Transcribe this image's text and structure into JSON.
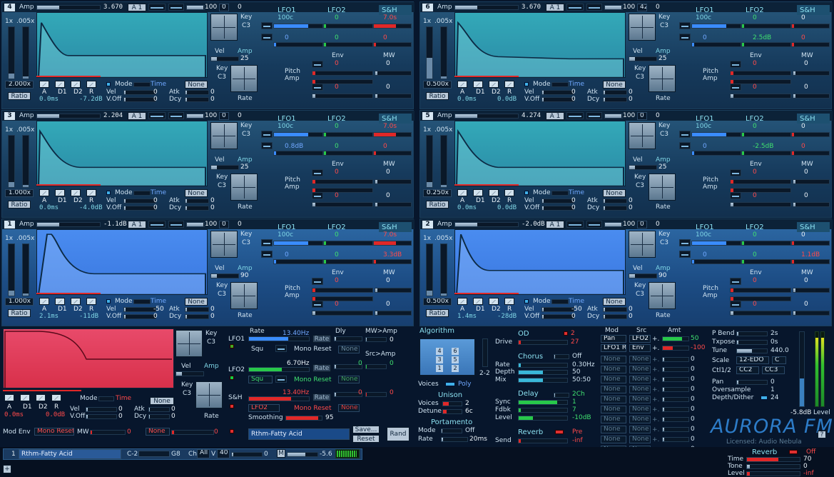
{
  "colors": {
    "accent": "#3a8cff",
    "red": "#e02828",
    "green": "#28c84a",
    "cyan": "#7fd6e6",
    "bg": "#07162c"
  },
  "ops": [
    {
      "num": "4",
      "amp": "3.670",
      "ratio": "2.000x",
      "a": "0.0ms",
      "dr": "-7.2dB",
      "lfo1": "100c",
      "sh": "7.0s",
      "vel": "25",
      "pitch_val": "0",
      "mono_amp": "0",
      "key": "C3",
      "red_val": "0",
      "green_val": "",
      "sel": false
    },
    {
      "num": "6",
      "amp": "3.670",
      "ratio": "0.500x",
      "a": "0.0ms",
      "dr": "0.0dB",
      "lfo1": "100c",
      "sh": "0",
      "vel": "25",
      "key": "C3",
      "green_val": "2.5dB",
      "box": "42"
    },
    {
      "num": "3",
      "amp": "2.204",
      "ratio": "1.000x",
      "a": "0.0ms",
      "dr": "-4.0dB",
      "lfo1": "100c",
      "sh": "7.0s",
      "vel": "25",
      "key": "C3",
      "blue_val": "0.8dB"
    },
    {
      "num": "5",
      "amp": "4.274",
      "ratio": "0.250x",
      "a": "0.0ms",
      "dr": "0.0dB",
      "lfo1": "100c",
      "sh": "0",
      "vel": "25",
      "key": "C3",
      "green_val": "-2.5dB"
    },
    {
      "num": "1",
      "amp": "-1.1dB",
      "ratio": "1.000x",
      "a": "2.1ms",
      "dr": "-11dB",
      "lfo1": "100c",
      "sh": "7.0s",
      "vel": "90",
      "key": "C3",
      "red_val": "3.3dB",
      "atk": "-50"
    },
    {
      "num": "2",
      "amp": "-2.0dB",
      "ratio": "0.500x",
      "a": "1.4ms",
      "dr": "-28dB",
      "lfo1": "100c",
      "sh": "0",
      "vel": "90",
      "key": "C3",
      "red_val": "1.1dB",
      "atk": "-50"
    }
  ],
  "labels": {
    "amp": "Amp",
    "a1": "A 1",
    "hundred": "100",
    "zero": "0",
    "one_x": "1x",
    "dot005": ".005x",
    "ratio": "Ratio",
    "key": "Key",
    "vel": "Vel",
    "rate": "Rate",
    "mode": "Mode",
    "time": "Time",
    "none": "None",
    "atk": "Atk",
    "dcy": "Dcy",
    "vel_l": "Vel",
    "voff": "V.Off",
    "lfo1": "LFO1",
    "lfo2": "LFO2",
    "sh": "S&H",
    "env": "Env",
    "mw": "MW",
    "pitch": "Pitch",
    "amp2": "Amp",
    "A": "A",
    "D1": "D1",
    "D2": "D2",
    "R": "R"
  },
  "bottom": {
    "mode": "Mode",
    "time": "Time",
    "none": "None",
    "a": "0.0ms",
    "dr": "0.0dB",
    "atk": "Atk",
    "dcy": "Dcy",
    "vel": "Vel",
    "voff": "V.Off",
    "amp": "Amp",
    "key": "Key",
    "c3": "C3",
    "rate": "Rate",
    "lfo1": "LFO1",
    "lfo2": "LFO2",
    "sh": "S&H",
    "rate_l": "Rate",
    "dly": "Dly",
    "mwamp": "MW>Amp",
    "srcamp": "Src>Amp",
    "lfo1_rate": "13.40Hz",
    "lfo2_rate": "6.70Hz",
    "sh_rate": "13.40Hz",
    "rate_btn": "Rate",
    "squ": "Squ",
    "mono_reset": "Mono Reset",
    "lfo2_btn": "LFO2",
    "smoothing": "Smoothing",
    "smooth_val": "95",
    "mod_env": "Mod Env",
    "mw": "MW",
    "preset": "Rthm-Fatty Acid",
    "save": "Save...",
    "reset": "Reset",
    "rand": "Rand",
    "algorithm": "Algorithm",
    "alg_nums": [
      "4",
      "6",
      "3",
      "5",
      "1",
      "2"
    ],
    "alg_val": "2-2",
    "voices": "Voices",
    "poly": "Poly",
    "unison": "Unison",
    "voices2": "Voices",
    "voices_val": "2",
    "detune": "Detune",
    "detune_val": "6c",
    "portamento": "Portamento",
    "port_mode": "Mode",
    "port_off": "Off",
    "port_rate": "Rate",
    "port_val": "20ms",
    "od": "OD",
    "drive": "Drive",
    "od_val1": "2",
    "od_val2": "27",
    "chorus": "Chorus",
    "chorus_off": "Off",
    "ch_rate": "Rate",
    "ch_rate_v": "0.30Hz",
    "ch_depth": "Depth",
    "ch_depth_v": "50",
    "ch_mix": "Mix",
    "ch_mix_v": "50:50",
    "delay": "Delay",
    "delay_v": "2Ch",
    "sync": "Sync",
    "sync_v": "1",
    "fdbk": "Fdbk",
    "fdbk_v": "7",
    "level": "Level",
    "level_v": "-10dB",
    "reverb": "Reverb",
    "pre": "Pre",
    "send": "Send",
    "send_v": "-inf",
    "mod": "Mod",
    "src": "Src",
    "amt": "Amt",
    "pan": "Pan",
    "plus": "+.",
    "v50": "50",
    "lfo1rt": "LFO1 Rt",
    "envsrc": "Env",
    "v_100": "-100",
    "pbend": "P Bend",
    "pbend_v": "2s",
    "txpose": "Txpose",
    "txpose_v": "0s",
    "tune": "Tune",
    "tune_v": "440.0",
    "scale": "Scale",
    "scale_v": "12-EDO",
    "scale_c": "C",
    "ctl": "Ctl1/2",
    "cc2": "CC2",
    "cc3": "CC3",
    "pan_l": "Pan",
    "pan_v": "0",
    "oversample": "Oversample",
    "over_v": "1",
    "depth_dither": "Depth/Dither",
    "dd_v": "24",
    "db_level": "-5.8dB",
    "level_l": "Level",
    "logo": "AURORA FM",
    "licensed": "Licensed: Audio Nebula",
    "help": "?"
  },
  "footer": {
    "ch1": "1",
    "preset": "Rthm-Fatty Acid",
    "c2": "C-2",
    "g8": "G8",
    "ch": "Ch",
    "all": "All",
    "v": "V",
    "v40": "40",
    "zero": "0",
    "m": "M",
    "minus": "-5.6",
    "plus": "+",
    "reverb": "Reverb",
    "off": "Off",
    "time": "Time",
    "time_v": "70",
    "tone": "Tone",
    "tone_v": "0",
    "level": "Level",
    "level_v": "-inf"
  }
}
